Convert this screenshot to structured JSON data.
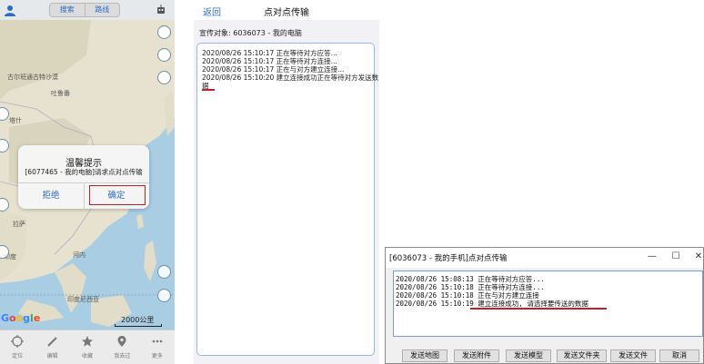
{
  "mobile_map": {
    "segment": {
      "search_label": "搜索",
      "route_label": "路线"
    },
    "map_labels": [
      "古尔班通古特沙漠",
      "吐鲁番",
      "塔什",
      "拉萨",
      "印度",
      "河内",
      "印度尼西亚"
    ],
    "dialog": {
      "title": "温馨提示",
      "message": "[6077465 - 我的电脑]请求点对点传输",
      "reject_label": "拒绝",
      "confirm_label": "确定"
    },
    "google_logo": "Google",
    "scale": "2000公里",
    "tabs": [
      {
        "label": "定位",
        "icon": "location-icon"
      },
      {
        "label": "编辑",
        "icon": "pencil-icon"
      },
      {
        "label": "收藏",
        "icon": "star-icon"
      },
      {
        "label": "我去过",
        "icon": "pin-icon"
      },
      {
        "label": "更多",
        "icon": "more-icon"
      }
    ]
  },
  "mobile_p2p": {
    "back_label": "返回",
    "title": "点对点传输",
    "target": "宣传对象: 6036073 - 我的电脑",
    "logs": [
      "2020/08/26 15:10:17 正在等待对方应答...",
      "2020/08/26 15:10:17 正在等待对方连接...",
      "2020/08/26 15:10:17 正在与对方建立连接...",
      "2020/08/26 15:10:20 建立连接成功正在等待对方发送数",
      "据"
    ]
  },
  "desktop_window": {
    "title": "[6036073 - 我的手机]点对点传输",
    "controls": {
      "minimize": "—",
      "maximize": "☐",
      "close": "✕"
    },
    "logs": [
      "2020/08/26 15:08:13 正在等待对方应答...",
      "2020/08/26 15:10:18 正在等待对方连接...",
      "2020/08/26 15:10:18 正在与对方建立连接",
      "2020/08/26 15:10:19 建立连接成功, 请选择要传送的数据"
    ],
    "buttons": {
      "send_map": "发送地图",
      "send_attachment": "发送附件",
      "send_model": "发送模型",
      "send_folder": "发送文件夹",
      "send_file": "发送文件",
      "cancel": "取消"
    }
  },
  "colors": {
    "ios_blue": "#2b6cc4",
    "highlight_red": "#c0202a",
    "ocean": "#a9cde2",
    "land": "#e8e4d4"
  }
}
